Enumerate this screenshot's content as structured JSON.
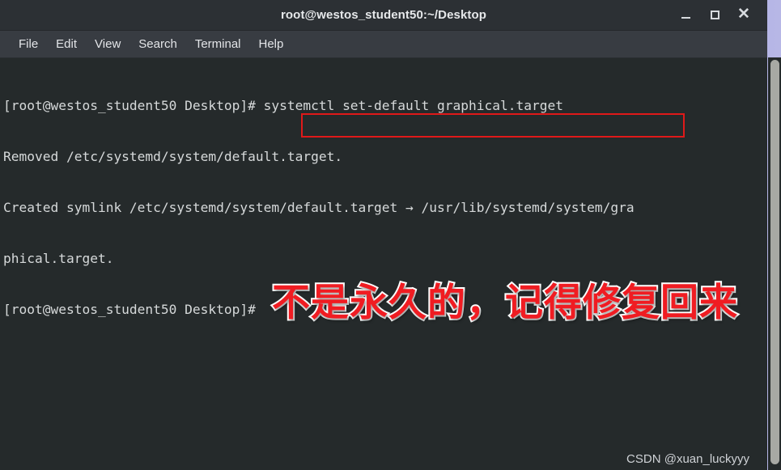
{
  "window": {
    "title": "root@westos_student50:~/Desktop",
    "controls": {
      "minimize": "minimize-icon",
      "maximize": "maximize-icon",
      "close": "✕"
    }
  },
  "menubar": {
    "items": [
      {
        "label": "File"
      },
      {
        "label": "Edit"
      },
      {
        "label": "View"
      },
      {
        "label": "Search"
      },
      {
        "label": "Terminal"
      },
      {
        "label": "Help"
      }
    ]
  },
  "terminal": {
    "prompt": "[root@westos_student50 Desktop]#",
    "command": "systemctl set-default graphical.target",
    "lines": [
      "[root@westos_student50 Desktop]# systemctl set-default graphical.target",
      "Removed /etc/systemd/system/default.target.",
      "Created symlink /etc/systemd/system/default.target → /usr/lib/systemd/system/gra",
      "phical.target.",
      "[root@westos_student50 Desktop]#"
    ],
    "background_color": "#252a2b",
    "text_color": "#d6d9da"
  },
  "annotation": {
    "text": "不是永久的，记得修复回来",
    "color": "#f01c22",
    "outline_color": "#ffffff"
  },
  "highlight_box": {
    "color": "#e01919",
    "target": "systemctl set-default graphical.target"
  },
  "watermark": {
    "text": "CSDN @xuan_luckyyy"
  },
  "desktop": {
    "background_color": "#9a9ad8"
  }
}
